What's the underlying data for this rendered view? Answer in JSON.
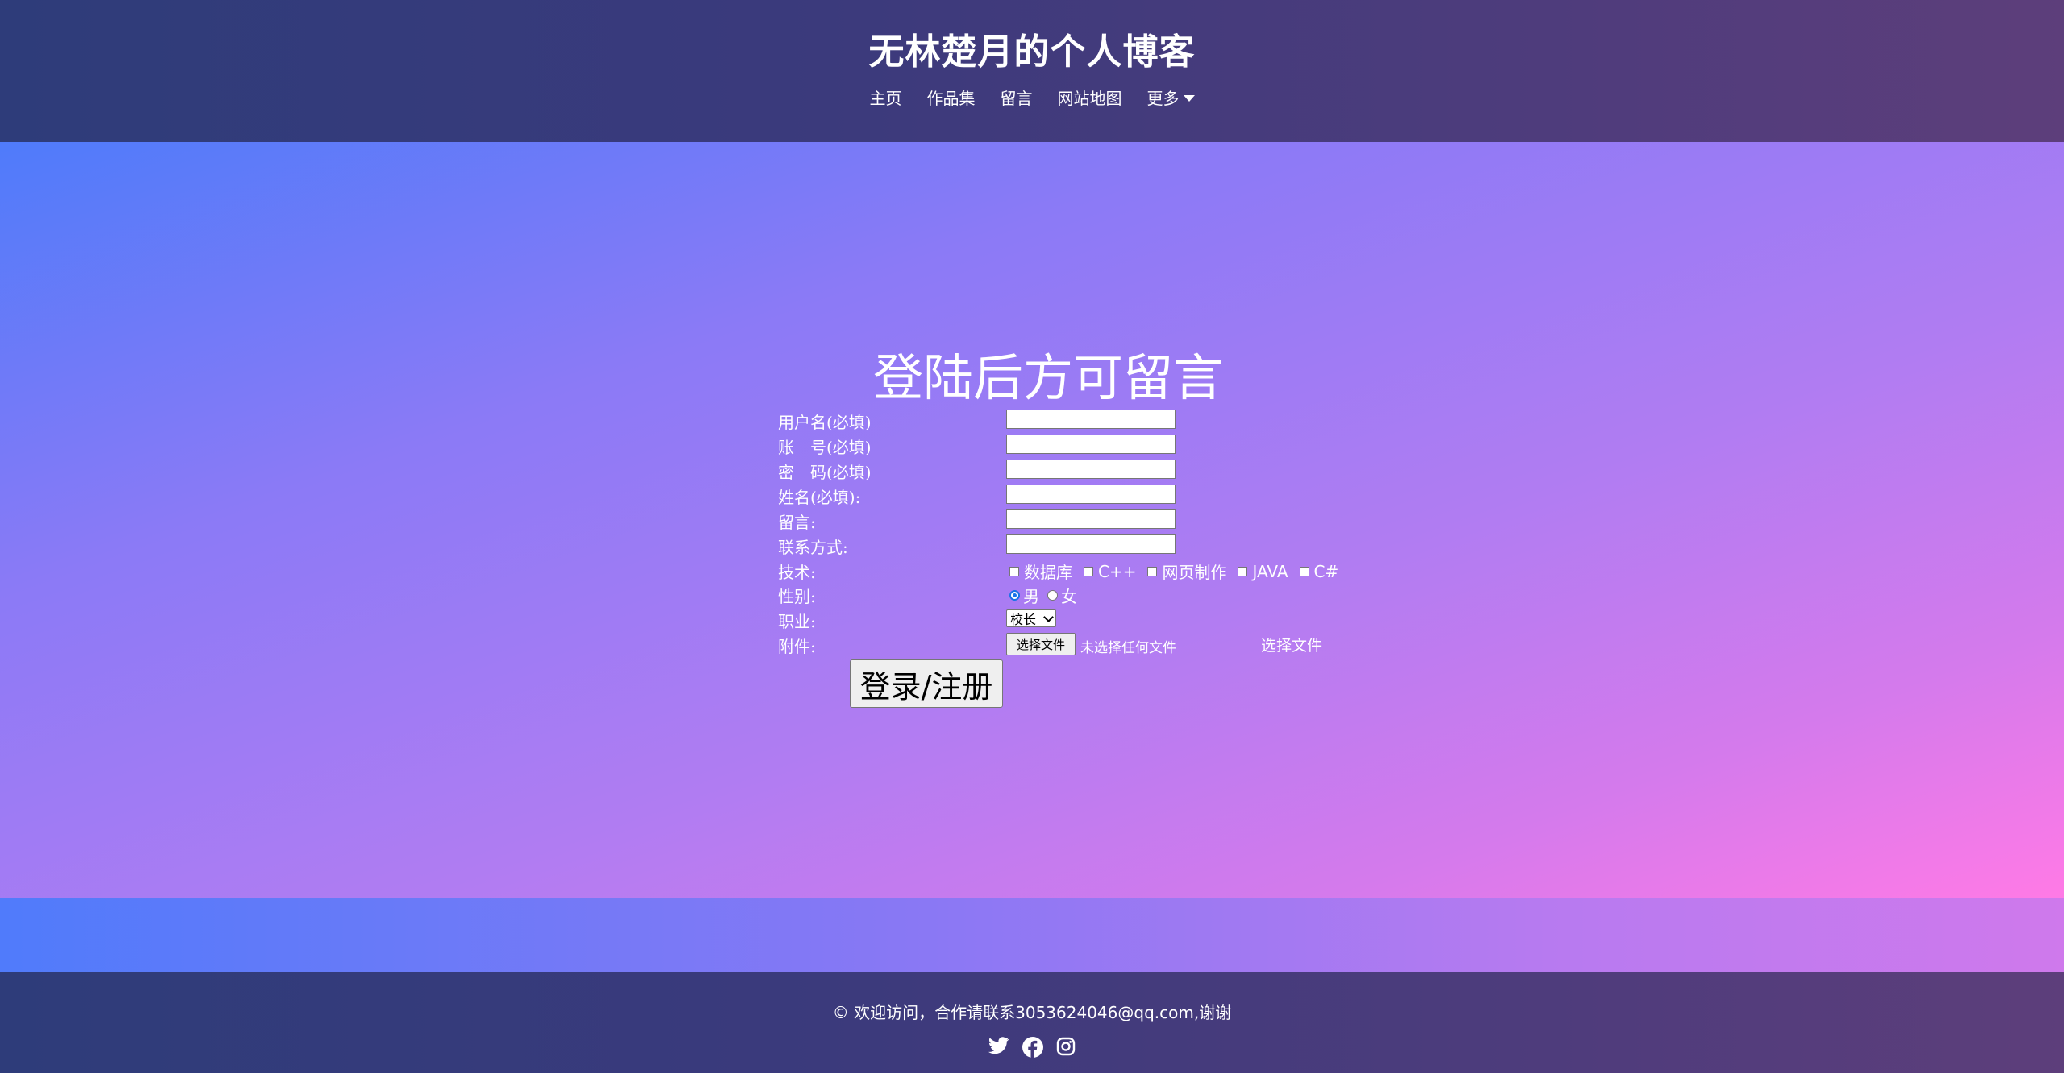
{
  "header": {
    "title": "无林楚月的个人博客",
    "nav": [
      {
        "label": "主页"
      },
      {
        "label": "作品集"
      },
      {
        "label": "留言"
      },
      {
        "label": "网站地图"
      },
      {
        "label": "更多"
      }
    ]
  },
  "form": {
    "title": "登陆后方可留言",
    "labels": {
      "username": "用户名(必填)",
      "account": "账　号(必填)",
      "password": "密　码(必填)",
      "name": "姓名(必填):",
      "message": "留言:",
      "contact": "联系方式:",
      "skills": "技术:",
      "gender": "性别:",
      "job": "职业:",
      "attachment": "附件:"
    },
    "values": {
      "username": "",
      "account": "",
      "password": "",
      "name": "",
      "message": "",
      "contact": ""
    },
    "skills": [
      "数据库",
      "C++",
      "网页制作",
      "JAVA",
      "C#"
    ],
    "gender": {
      "options": [
        "男",
        "女"
      ],
      "selected": "男"
    },
    "job_selected": "校长",
    "file_button": "选择文件",
    "file_status": "未选择任何文件",
    "file_link": "选择文件",
    "submit": "登录/注册"
  },
  "footer": {
    "text": "© 欢迎访问，合作请联系3053624046@qq.com,谢谢",
    "social": [
      "twitter-icon",
      "facebook-icon",
      "instagram-icon"
    ]
  },
  "colors": {
    "header_bg": "#3b3a7c",
    "gradient_start": "#4f7bfa",
    "gradient_end": "#ff7ae6",
    "radio_accent": "#1a73e8"
  }
}
